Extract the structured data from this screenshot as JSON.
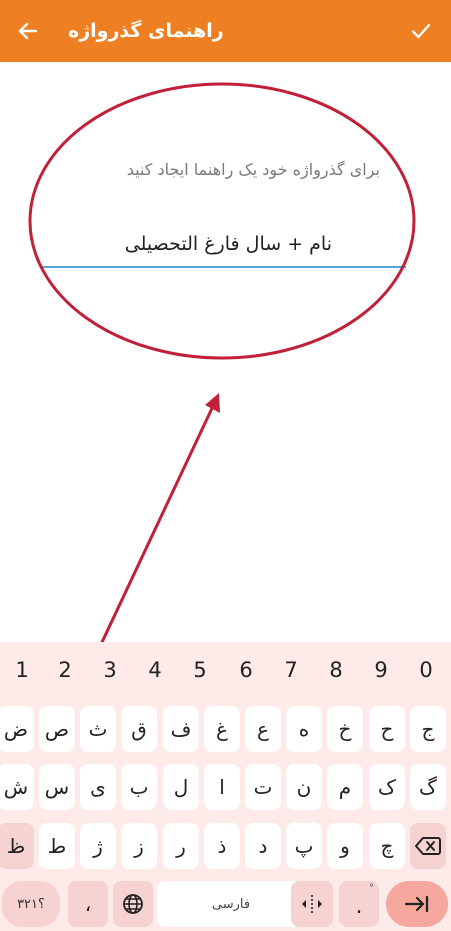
{
  "appbar": {
    "title": "راهنمای گذرواژه",
    "back_icon": "arrow-left-icon",
    "confirm_icon": "check-icon",
    "color": "#ee7f22"
  },
  "form": {
    "helper": "برای گذرواژه خود یک راهنما ایجاد کنید",
    "hint_value": "نام + سال فارغ التحصیلی",
    "underline_color": "#5aa3d8"
  },
  "annotation": {
    "color": "#c0203a"
  },
  "keyboard": {
    "numbers": [
      "1",
      "2",
      "3",
      "4",
      "5",
      "6",
      "7",
      "8",
      "9",
      "0"
    ],
    "row1": [
      "ض",
      "ص",
      "ث",
      "ق",
      "ف",
      "غ",
      "ع",
      "ه",
      "خ",
      "ح",
      "ج"
    ],
    "row2": [
      "ش",
      "س",
      "ی",
      "ب",
      "ل",
      "ا",
      "ت",
      "ن",
      "م",
      "ک",
      "گ"
    ],
    "row3": [
      "ظ",
      "ط",
      "ژ",
      "ز",
      "ر",
      "ذ",
      "د",
      "پ",
      "و",
      "چ"
    ],
    "symbols_label": "؟۳۲۱",
    "comma": "،",
    "space_label": "فارسی",
    "period": ".",
    "period_hint": "°",
    "globe_icon": "globe-icon",
    "cursor_icon": "cursor-move-icon",
    "backspace_icon": "backspace-icon",
    "enter_icon": "next-field-icon"
  }
}
